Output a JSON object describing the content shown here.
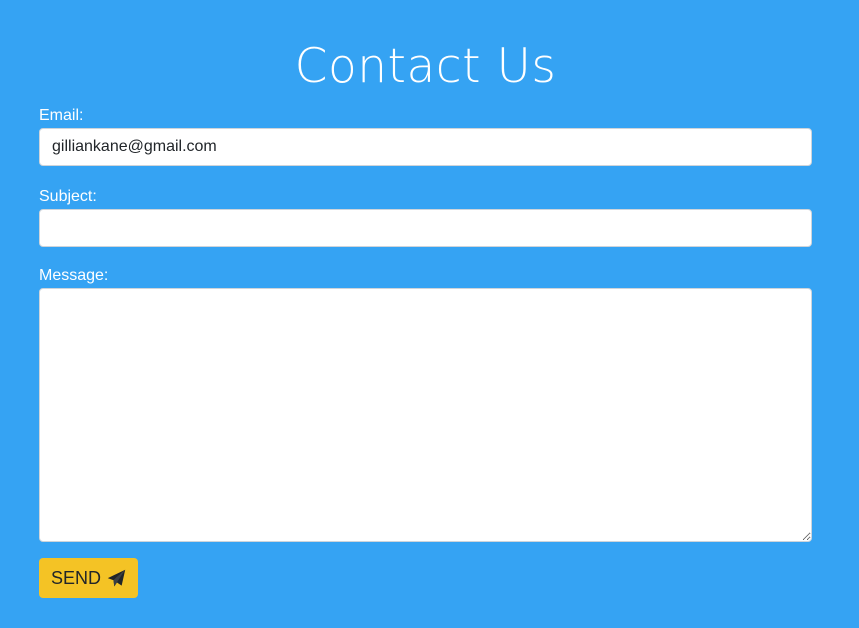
{
  "page": {
    "title": "Contact Us",
    "background_color": "#35a3f3"
  },
  "form": {
    "email": {
      "label": "Email:",
      "value": "gilliankane@gmail.com"
    },
    "subject": {
      "label": "Subject:",
      "value": ""
    },
    "message": {
      "label": "Message:",
      "value": ""
    },
    "send_button": {
      "label": "SEND",
      "icon": "paper-plane-icon",
      "color": "#f4c325"
    }
  }
}
